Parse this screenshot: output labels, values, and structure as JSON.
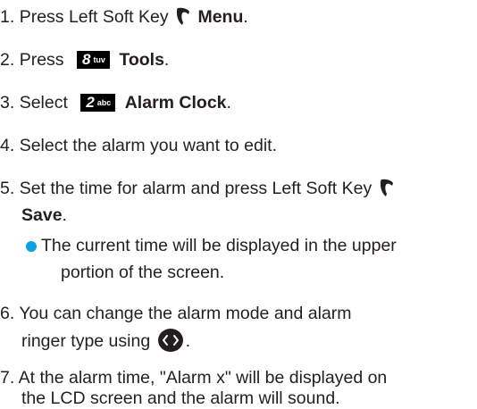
{
  "steps": [
    {
      "number": "1.",
      "prefix": "Press Left Soft Key",
      "label": "Menu",
      "suffix": "."
    },
    {
      "number": "2.",
      "prefix": "Press",
      "key": "8",
      "key_sub": "tuv",
      "label": "Tools",
      "suffix": "."
    },
    {
      "number": "3.",
      "prefix": "Select",
      "key": "2",
      "key_sub": "abc",
      "label": "Alarm Clock",
      "suffix": "."
    },
    {
      "number": "4.",
      "text": "Select the alarm you want to edit."
    },
    {
      "number": "5.",
      "prefix": "Set the time for alarm and press Left Soft Key",
      "label": "Save",
      "suffix": "."
    },
    {
      "number": "6.",
      "line1": "You can change the alarm mode and alarm",
      "line2_prefix": "ringer type using",
      "suffix": "."
    },
    {
      "number": "7.",
      "line1": "At the alarm time, \"Alarm x\" will be displayed on",
      "line2": "the LCD screen and the alarm will sound."
    }
  ],
  "note": {
    "line1": "The current time will be displayed in the upper",
    "line2": "portion of the screen."
  },
  "colors": {
    "text": "#231f20",
    "bullet": "#0aa3e3",
    "key_badge": "#000000"
  },
  "icons": [
    "left-soft-key-icon",
    "nav-left-right-icon"
  ]
}
